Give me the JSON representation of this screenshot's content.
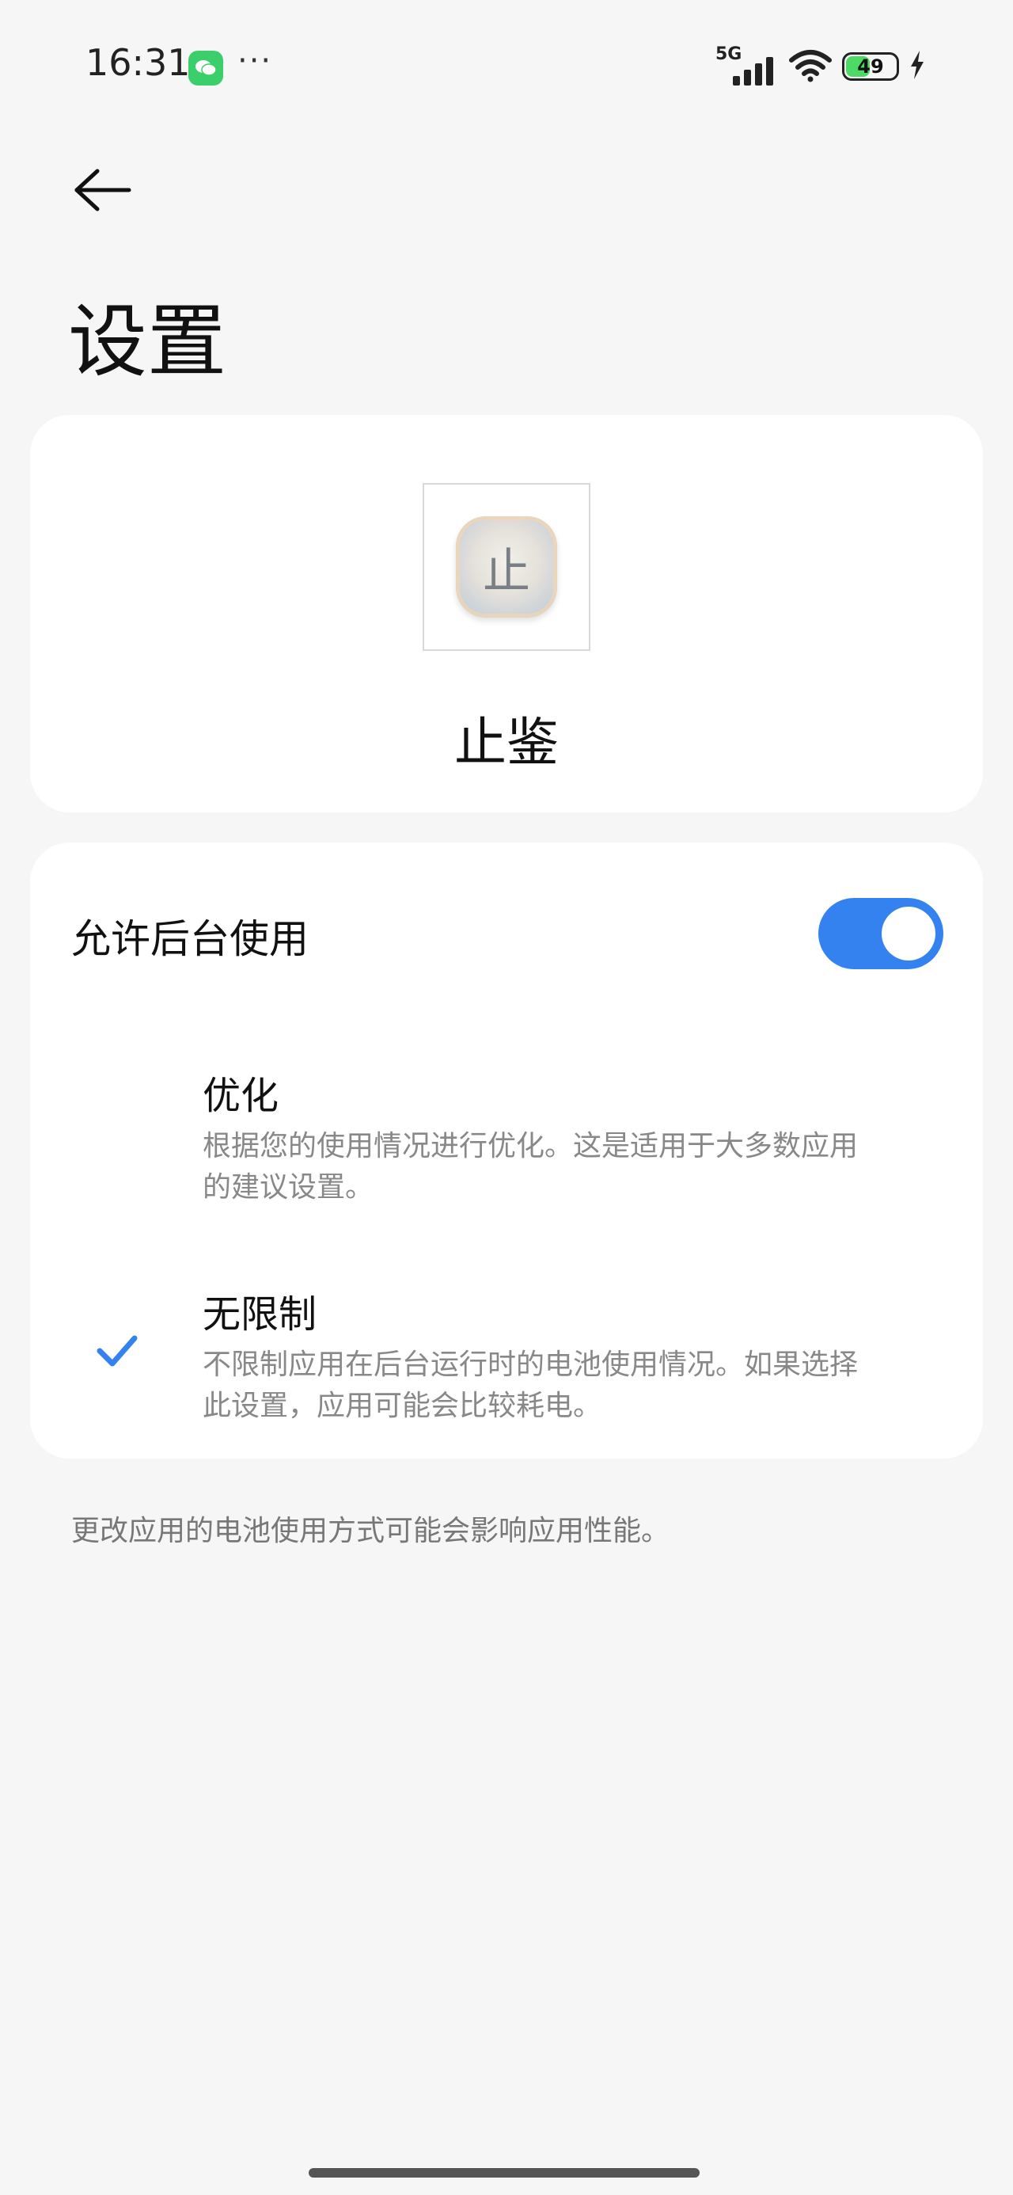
{
  "status_bar": {
    "time": "16:31",
    "more": "···",
    "network": "5G",
    "battery_level": "49",
    "battery_percent": 49,
    "chat_icon": "wechat-icon",
    "wifi_icon": "wifi-icon",
    "charging_icon": "lightning-icon"
  },
  "header": {
    "back_icon": "arrow-left-icon",
    "title": "设置"
  },
  "app": {
    "icon_char": "止",
    "name": "止鉴"
  },
  "background": {
    "label": "允许后台使用",
    "enabled": true,
    "accent": "#3482f0"
  },
  "options": [
    {
      "title": "优化",
      "desc_line1": "根据您的使用情况进行优化。这是适用于大多数应用",
      "desc_line2": "的建议设置。",
      "selected": false
    },
    {
      "title": "无限制",
      "desc_line1": "不限制应用在后台运行时的电池使用情况。如果选择",
      "desc_line2": "此设置，应用可能会比较耗电。",
      "selected": true
    }
  ],
  "footer": {
    "note": "更改应用的电池使用方式可能会影响应用性能。"
  }
}
